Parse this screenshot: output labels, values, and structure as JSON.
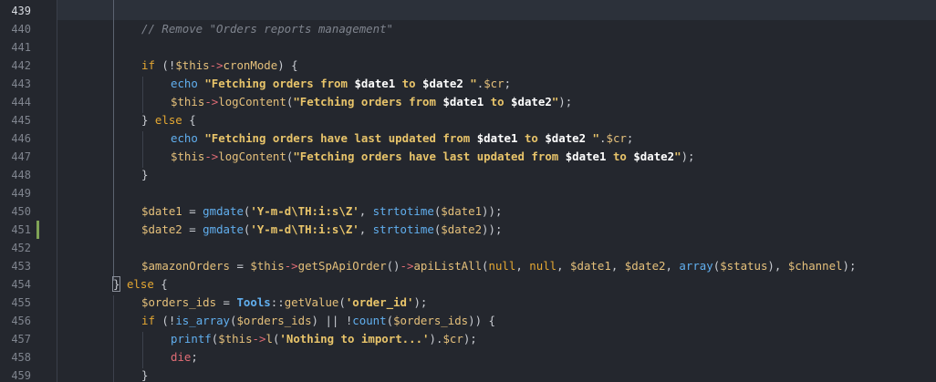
{
  "editor": {
    "current_line": "439",
    "lines": [
      {
        "no": "439",
        "indent": 0,
        "tokens": []
      },
      {
        "no": "440",
        "indent": 1,
        "tokens": [
          {
            "c": "cm",
            "t": "// Remove \"Orders reports management\""
          }
        ]
      },
      {
        "no": "441",
        "indent": 0,
        "tokens": []
      },
      {
        "no": "442",
        "indent": 1,
        "tokens": [
          {
            "c": "kw",
            "t": "if"
          },
          {
            "c": "pl",
            "t": " ("
          },
          {
            "c": "pl",
            "t": "!"
          },
          {
            "c": "th",
            "t": "$this"
          },
          {
            "c": "ar",
            "t": "->"
          },
          {
            "c": "fy",
            "t": "cronMode"
          },
          {
            "c": "pl",
            "t": ") {"
          }
        ]
      },
      {
        "no": "443",
        "indent": 2,
        "tokens": [
          {
            "c": "fn",
            "t": "echo"
          },
          {
            "c": "pl",
            "t": " "
          },
          {
            "c": "st",
            "t": "\"Fetching orders from "
          },
          {
            "c": "sv",
            "t": "$date1"
          },
          {
            "c": "st",
            "t": " to "
          },
          {
            "c": "sv",
            "t": "$date2"
          },
          {
            "c": "st",
            "t": " \""
          },
          {
            "c": "pl",
            "t": "."
          },
          {
            "c": "vr",
            "t": "$cr"
          },
          {
            "c": "pl",
            "t": ";"
          }
        ]
      },
      {
        "no": "444",
        "indent": 2,
        "tokens": [
          {
            "c": "th",
            "t": "$this"
          },
          {
            "c": "ar",
            "t": "->"
          },
          {
            "c": "fy",
            "t": "logContent"
          },
          {
            "c": "pl",
            "t": "("
          },
          {
            "c": "st",
            "t": "\"Fetching orders from "
          },
          {
            "c": "sv",
            "t": "$date1"
          },
          {
            "c": "st",
            "t": " to "
          },
          {
            "c": "sv",
            "t": "$date2"
          },
          {
            "c": "st",
            "t": "\""
          },
          {
            "c": "pl",
            "t": ");"
          }
        ]
      },
      {
        "no": "445",
        "indent": 1,
        "tokens": [
          {
            "c": "pl",
            "t": "} "
          },
          {
            "c": "kw",
            "t": "else"
          },
          {
            "c": "pl",
            "t": " {"
          }
        ]
      },
      {
        "no": "446",
        "indent": 2,
        "tokens": [
          {
            "c": "fn",
            "t": "echo"
          },
          {
            "c": "pl",
            "t": " "
          },
          {
            "c": "st",
            "t": "\"Fetching orders have last updated from "
          },
          {
            "c": "sv",
            "t": "$date1"
          },
          {
            "c": "st",
            "t": " to "
          },
          {
            "c": "sv",
            "t": "$date2"
          },
          {
            "c": "st",
            "t": " \""
          },
          {
            "c": "pl",
            "t": "."
          },
          {
            "c": "vr",
            "t": "$cr"
          },
          {
            "c": "pl",
            "t": ";"
          }
        ]
      },
      {
        "no": "447",
        "indent": 2,
        "tokens": [
          {
            "c": "th",
            "t": "$this"
          },
          {
            "c": "ar",
            "t": "->"
          },
          {
            "c": "fy",
            "t": "logContent"
          },
          {
            "c": "pl",
            "t": "("
          },
          {
            "c": "st",
            "t": "\"Fetching orders have last updated from "
          },
          {
            "c": "sv",
            "t": "$date1"
          },
          {
            "c": "st",
            "t": " to "
          },
          {
            "c": "sv",
            "t": "$date2"
          },
          {
            "c": "st",
            "t": "\""
          },
          {
            "c": "pl",
            "t": ");"
          }
        ]
      },
      {
        "no": "448",
        "indent": 1,
        "tokens": [
          {
            "c": "pl",
            "t": "}"
          }
        ]
      },
      {
        "no": "449",
        "indent": 0,
        "tokens": []
      },
      {
        "no": "450",
        "indent": 1,
        "tokens": [
          {
            "c": "vr",
            "t": "$date1"
          },
          {
            "c": "pl",
            "t": " = "
          },
          {
            "c": "fn",
            "t": "gmdate"
          },
          {
            "c": "pl",
            "t": "("
          },
          {
            "c": "st",
            "t": "'Y-m-d\\TH:i:s\\Z'"
          },
          {
            "c": "pl",
            "t": ", "
          },
          {
            "c": "fn",
            "t": "strtotime"
          },
          {
            "c": "pl",
            "t": "("
          },
          {
            "c": "vr",
            "t": "$date1"
          },
          {
            "c": "pl",
            "t": "));"
          }
        ]
      },
      {
        "no": "451",
        "indent": 1,
        "mark": true,
        "tokens": [
          {
            "c": "vr",
            "t": "$date2"
          },
          {
            "c": "pl",
            "t": " = "
          },
          {
            "c": "fn",
            "t": "gmdate"
          },
          {
            "c": "pl",
            "t": "("
          },
          {
            "c": "st",
            "t": "'Y-m-d\\TH:i:s\\Z'"
          },
          {
            "c": "pl",
            "t": ", "
          },
          {
            "c": "fn",
            "t": "strtotime"
          },
          {
            "c": "pl",
            "t": "("
          },
          {
            "c": "vr",
            "t": "$date2"
          },
          {
            "c": "pl",
            "t": "));"
          }
        ]
      },
      {
        "no": "452",
        "indent": 0,
        "tokens": []
      },
      {
        "no": "453",
        "indent": 1,
        "tokens": [
          {
            "c": "vr",
            "t": "$amazonOrders"
          },
          {
            "c": "pl",
            "t": " = "
          },
          {
            "c": "th",
            "t": "$this"
          },
          {
            "c": "ar",
            "t": "->"
          },
          {
            "c": "fy",
            "t": "getSpApiOrder"
          },
          {
            "c": "pl",
            "t": "()"
          },
          {
            "c": "ar",
            "t": "->"
          },
          {
            "c": "fy",
            "t": "apiListAll"
          },
          {
            "c": "pl",
            "t": "("
          },
          {
            "c": "kw",
            "t": "null"
          },
          {
            "c": "pl",
            "t": ", "
          },
          {
            "c": "kw",
            "t": "null"
          },
          {
            "c": "pl",
            "t": ", "
          },
          {
            "c": "vr",
            "t": "$date1"
          },
          {
            "c": "pl",
            "t": ", "
          },
          {
            "c": "vr",
            "t": "$date2"
          },
          {
            "c": "pl",
            "t": ", "
          },
          {
            "c": "fn",
            "t": "array"
          },
          {
            "c": "pl",
            "t": "("
          },
          {
            "c": "vr",
            "t": "$status"
          },
          {
            "c": "pl",
            "t": "), "
          },
          {
            "c": "vr",
            "t": "$channel"
          },
          {
            "c": "pl",
            "t": ");"
          }
        ]
      },
      {
        "no": "454",
        "indent": 0,
        "tokens": [
          {
            "c": "pl bracket-box",
            "t": "}"
          },
          {
            "c": "pl",
            "t": " "
          },
          {
            "c": "kw",
            "t": "else"
          },
          {
            "c": "pl",
            "t": " {"
          }
        ]
      },
      {
        "no": "455",
        "indent": 1,
        "tokens": [
          {
            "c": "vr",
            "t": "$orders_ids"
          },
          {
            "c": "pl",
            "t": " = "
          },
          {
            "c": "cl",
            "t": "Tools"
          },
          {
            "c": "pl",
            "t": "::"
          },
          {
            "c": "fy",
            "t": "getValue"
          },
          {
            "c": "pl",
            "t": "("
          },
          {
            "c": "st",
            "t": "'order_id'"
          },
          {
            "c": "pl",
            "t": ");"
          }
        ]
      },
      {
        "no": "456",
        "indent": 1,
        "tokens": [
          {
            "c": "kw",
            "t": "if"
          },
          {
            "c": "pl",
            "t": " (!"
          },
          {
            "c": "fn",
            "t": "is_array"
          },
          {
            "c": "pl",
            "t": "("
          },
          {
            "c": "vr",
            "t": "$orders_ids"
          },
          {
            "c": "pl",
            "t": ") || !"
          },
          {
            "c": "fn",
            "t": "count"
          },
          {
            "c": "pl",
            "t": "("
          },
          {
            "c": "vr",
            "t": "$orders_ids"
          },
          {
            "c": "pl",
            "t": ")) {"
          }
        ]
      },
      {
        "no": "457",
        "indent": 2,
        "tokens": [
          {
            "c": "fn",
            "t": "printf"
          },
          {
            "c": "pl",
            "t": "("
          },
          {
            "c": "th",
            "t": "$this"
          },
          {
            "c": "ar",
            "t": "->"
          },
          {
            "c": "fy",
            "t": "l"
          },
          {
            "c": "pl",
            "t": "("
          },
          {
            "c": "st",
            "t": "'Nothing to import...'"
          },
          {
            "c": "pl",
            "t": ")."
          },
          {
            "c": "vr",
            "t": "$cr"
          },
          {
            "c": "pl",
            "t": ");"
          }
        ]
      },
      {
        "no": "458",
        "indent": 2,
        "tokens": [
          {
            "c": "pk",
            "t": "die"
          },
          {
            "c": "pl",
            "t": ";"
          }
        ]
      },
      {
        "no": "459",
        "indent": 1,
        "tokens": [
          {
            "c": "pl",
            "t": "}"
          }
        ]
      }
    ]
  }
}
